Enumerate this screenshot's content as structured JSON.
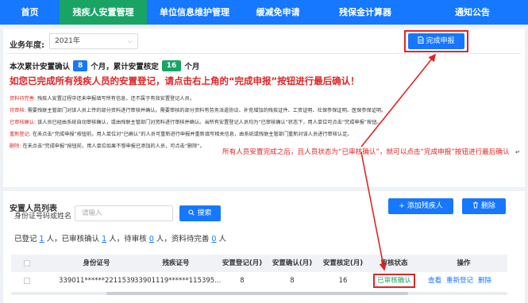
{
  "nav": {
    "items": [
      "首页",
      "残疾人安置管理",
      "单位信息维护管理",
      "缓减免申请",
      "残保金计算器",
      "通知公告"
    ],
    "active_index": 1,
    "colors": {
      "bar": "#1677ff",
      "active": "#19a466"
    }
  },
  "business_year": {
    "label": "业务年度:",
    "value": "2021年"
  },
  "complete_button": {
    "label": "完成申报",
    "icon": "document-icon"
  },
  "stats": {
    "prefix": "本次累计安置确认",
    "confirmed": "8",
    "mid": "个月，累计安置核定",
    "verified": "16",
    "suffix": "个月"
  },
  "notice": "如您已完成所有残疾人员的安置登记，请点击右上角的“完成申报”按钮进行最后确认！",
  "help_lines": [
    {
      "key": "资料待完善:",
      "text": "残疾人安置过程中还未申报填写所有信息，还不属于有效安置登记人员。"
    },
    {
      "key": "待审核:",
      "text": "需要残联主管部门对该人员上传的部分资料进行审核并确认。需要审核的部分资料有劳务派遣协议、补充增加的残疾证件、工资证明、社保参保证明、医保参保证明。"
    },
    {
      "key": "已审核确认:",
      "text": "该人员已经由系统自动审核确认，或由残联主管部门对资料进行审核并确认。当所有安置登记人员均为“已审核确认”状态下，用人单位可点击“完成申报”按钮。"
    },
    {
      "key": "重新登记:",
      "text": "在未点击“完成申报”按钮前，用人单位对“已确认”的人员可重新进行申报并重新填写相关信息，由系统或残联主管部门重新对该人员进行审核认定。"
    },
    {
      "key": "删除:",
      "text": "在未点击“完成申报”按钮前，用人单位如果不想申报已添加的人员，可点击“删除”。"
    }
  ],
  "annotation": "所有人员安置完成之后，且人员状态为“已审核确认”，就可以点击“完成申报”按钮进行最后确认",
  "edge_mark": "↵",
  "list": {
    "title": "安置人员列表",
    "add_button": "+ 添加残疾人",
    "delete_button": "删除",
    "search": {
      "label": "身份证号码或姓名",
      "placeholder": "请输入",
      "button": "搜索"
    },
    "summary": {
      "registered_label": "已登记",
      "registered": "1",
      "reviewed_label": "人，已审核确认",
      "reviewed": "1",
      "pending_label": "人，待审核",
      "pending": "0",
      "incomplete_label": "人，资料待完善",
      "incomplete": "0",
      "end": "人"
    },
    "columns": [
      "身份证号",
      "残疾证号",
      "安置登记(月)",
      "安置确认(月)",
      "安置核定(月)",
      "审核状态",
      "操作"
    ],
    "rows": [
      {
        "id_number": "339011******2211539",
        "disability_cert": "33901119******115395...",
        "registered_months": "8",
        "confirmed_months": "8",
        "verified_months": "16",
        "status": "已审核确认",
        "actions": [
          "查看",
          "重新登记",
          "删除"
        ]
      }
    ]
  }
}
